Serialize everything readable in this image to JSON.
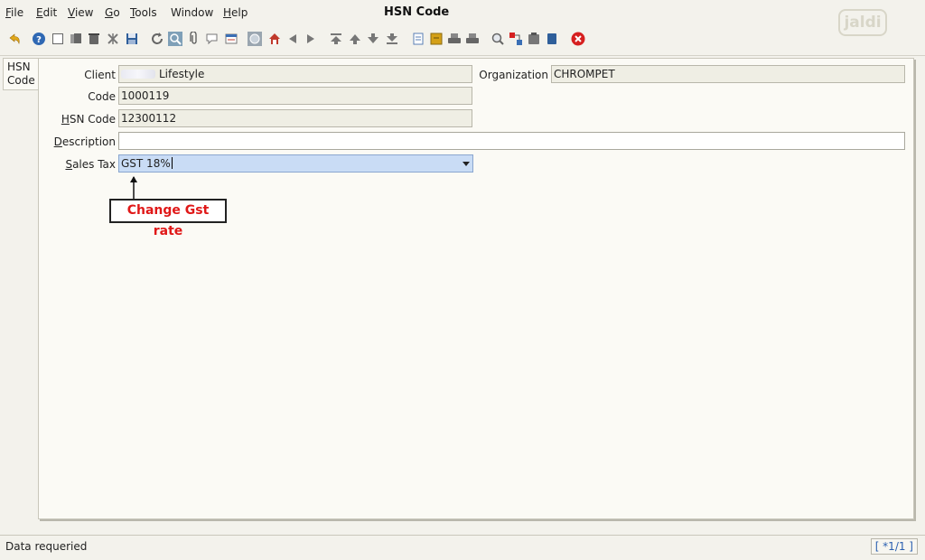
{
  "menubar": {
    "items": [
      {
        "u": "F",
        "rest": "ile"
      },
      {
        "u": "E",
        "rest": "dit"
      },
      {
        "u": "V",
        "rest": "iew"
      },
      {
        "u": "G",
        "rest": "o"
      },
      {
        "u": "T",
        "rest": "ools"
      },
      {
        "u": "",
        "rest": "Window"
      },
      {
        "u": "H",
        "rest": "elp"
      }
    ],
    "title": "HSN Code",
    "logo": "jaldi"
  },
  "toolbar": {
    "icons": [
      "undo-icon",
      "help-icon",
      "new-icon",
      "copy-icon",
      "delete-icon",
      "delete-selection-icon",
      "save-icon",
      "refresh-icon",
      "find-icon",
      "attachment-icon",
      "chat-icon",
      "grid-toggle-icon",
      "history-icon",
      "home-icon",
      "back-icon",
      "forward-icon",
      "first-record-icon",
      "previous-record-icon",
      "next-record-icon",
      "last-record-icon",
      "report-icon",
      "archive-icon",
      "print-icon",
      "print-preview-icon",
      "zoom-across-icon",
      "request-icon",
      "product-info-icon",
      "workflow-icon",
      "close-window-icon"
    ]
  },
  "side_tab": {
    "line1": "HSN",
    "line2": "Code"
  },
  "form": {
    "client": {
      "label": "Client",
      "value": "Lifestyle"
    },
    "organization": {
      "label": "Organization",
      "value": "CHROMPET"
    },
    "code": {
      "label": "Code",
      "value": "1000119"
    },
    "hsn_code": {
      "label_u": "H",
      "label_rest": "SN Code",
      "value": "12300112"
    },
    "description": {
      "label_u": "D",
      "label_rest": "escription",
      "value": ""
    },
    "sales_tax": {
      "label_u": "S",
      "label_rest": "ales Tax",
      "value": "GST 18%"
    }
  },
  "annotation": {
    "text": "Change Gst rate",
    "color": "#e01818"
  },
  "status": {
    "message": "Data requeried",
    "record": "[ *1/1 ]"
  }
}
